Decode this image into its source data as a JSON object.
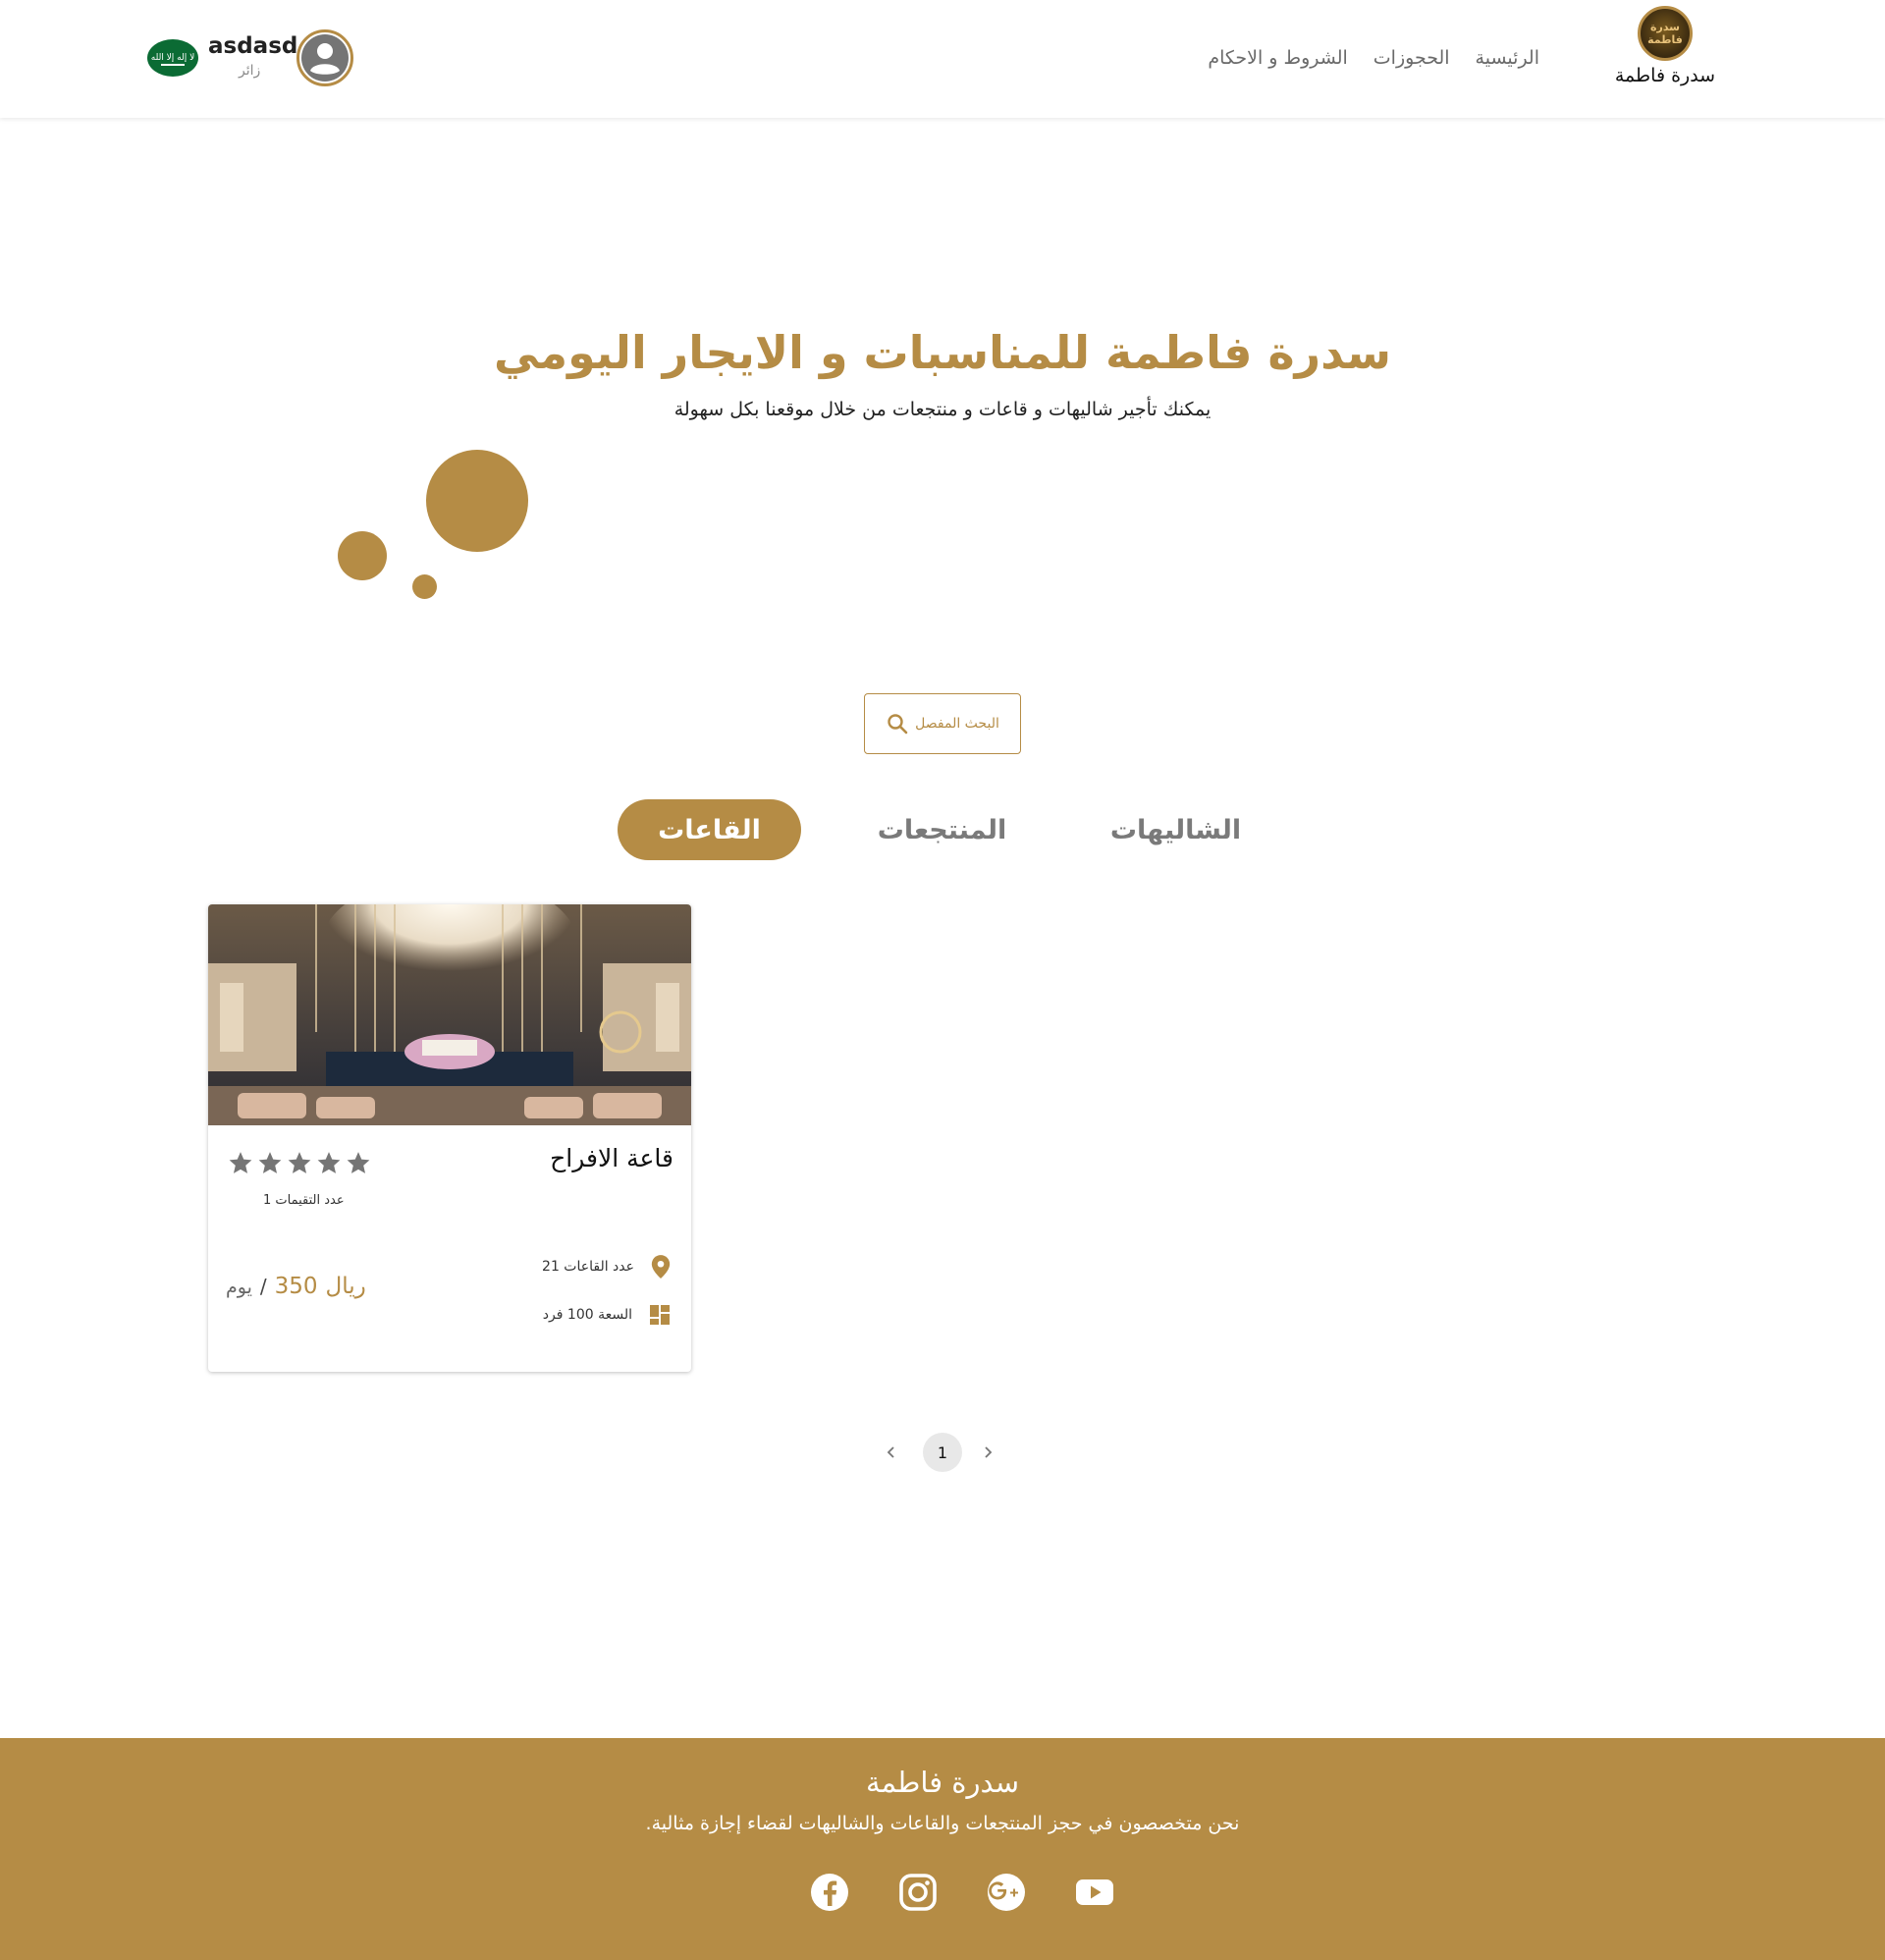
{
  "header": {
    "logo_text_line1": "سدرة",
    "logo_text_line2": "فاطمة",
    "brand_name": "سدرة فاطمة",
    "nav": [
      {
        "label": "الرئيسية"
      },
      {
        "label": "الحجوزات"
      },
      {
        "label": "الشروط و الاحكام"
      }
    ],
    "user": {
      "name": "asdasd",
      "role": "زائر",
      "flag_text": "لا إله إلا الله"
    }
  },
  "hero": {
    "title": "سدرة فاطمة للمناسبات و الايجار اليومي",
    "subtitle": "يمكنك تأجير شاليهات و قاعات و منتجعات من خلال موقعنا بكل سهولة"
  },
  "search": {
    "label": "البحث المفصل",
    "icon": "search-icon"
  },
  "tabs": [
    {
      "label": "الشاليهات",
      "active": false
    },
    {
      "label": "المنتجعات",
      "active": false
    },
    {
      "label": "القاعات",
      "active": true
    }
  ],
  "listings": [
    {
      "title": "قاعة الافراح",
      "rating": 5,
      "ratings_count_label": "عدد التقيمات 1",
      "halls_label": "عدد القاعات 21",
      "capacity_label": "السعة 100 فرد",
      "price": "350",
      "currency": "ريال",
      "separator": "/",
      "unit": "يوم"
    }
  ],
  "pagination": {
    "current_page": "1"
  },
  "footer": {
    "name": "سدرة فاطمة",
    "description": "نحن متخصصون في حجز المنتجعات والقاعات والشاليهات لقضاء إجازة مثالية.",
    "social": [
      "facebook-icon",
      "instagram-icon",
      "google-plus-icon",
      "youtube-icon"
    ]
  },
  "colors": {
    "accent": "#b58c45",
    "flag_green": "#0b6b34",
    "text": "#222222",
    "muted": "#7a7a7a"
  }
}
